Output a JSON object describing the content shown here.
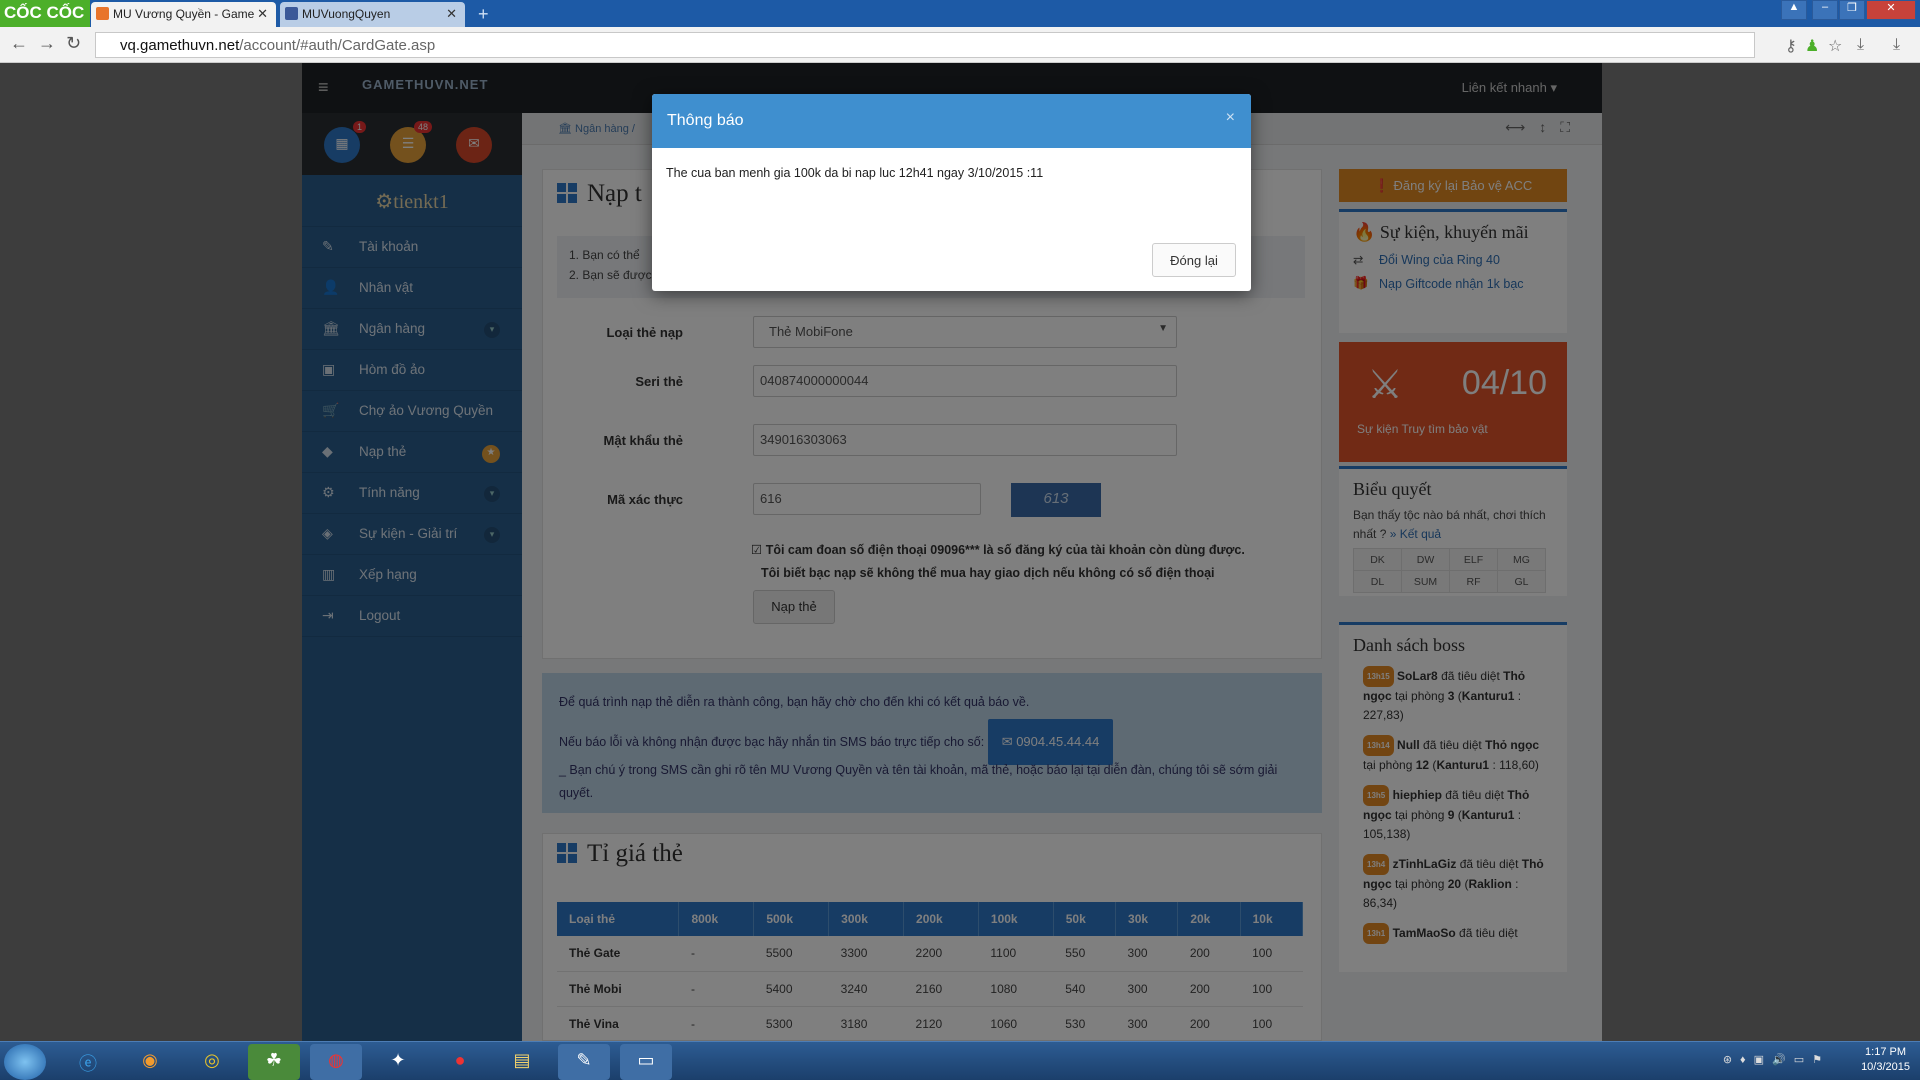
{
  "browser": {
    "brand": "CỐC CỐC",
    "tabs": [
      {
        "title": "MU Vương Quyền - Game"
      },
      {
        "title": "MUVuongQuyen"
      }
    ],
    "url_host": "vq.gamethuvn.net",
    "url_path": "/account/#auth/CardGate.asp"
  },
  "site": {
    "logo": "GAMETHUVN.NET",
    "quick_links": "Liên kết nhanh ▾",
    "badges": {
      "calendar": "1",
      "messages": "48"
    },
    "username": "tienkt1",
    "menu": [
      {
        "label": "Tài khoản",
        "icon": "✎"
      },
      {
        "label": "Nhân vật",
        "icon": "👤"
      },
      {
        "label": "Ngân hàng",
        "icon": "🏛"
      },
      {
        "label": "Hòm đồ ảo",
        "icon": "▣"
      },
      {
        "label": "Chợ ảo Vương Quyền",
        "icon": "🛒"
      },
      {
        "label": "Nạp thẻ",
        "icon": "◆"
      },
      {
        "label": "Tính năng",
        "icon": "⚙"
      },
      {
        "label": "Sự kiện - Giải trí",
        "icon": "◈"
      },
      {
        "label": "Xếp hạng",
        "icon": "▥"
      },
      {
        "label": "Logout",
        "icon": "⇥"
      }
    ],
    "breadcrumb": "Ngân hàng  /"
  },
  "form": {
    "title": "Nạp t",
    "notes": [
      "1. Bạn có thể",
      "2. Bạn sẽ được"
    ],
    "card_type_label": "Loại thẻ nạp",
    "card_type_value": "Thẻ MobiFone",
    "serial_label": "Seri thẻ",
    "serial_value": "040874000000044",
    "pin_label": "Mật khẩu thẻ",
    "pin_value": "349016303063",
    "captcha_label": "Mã xác thực",
    "captcha_value": "616",
    "captcha_image_text": "613",
    "agree_line1": "Tôi cam đoan số điện thoại 09096*** là số đăng ký của tài khoản còn dùng được.",
    "agree_line2": "Tôi biết bạc nạp sẽ không thể mua hay giao dịch nếu không có số điện thoại",
    "submit": "Nạp thẻ"
  },
  "info": {
    "line1": "Để quá trình nạp thẻ diễn ra thành công, bạn hãy chờ cho đến khi có kết quả báo về.",
    "line2": "Nếu báo lỗi và không nhận được bạc hãy nhắn tin SMS báo trực tiếp cho số:",
    "phone": "0904.45.44.44",
    "line3": "_ Bạn chú ý trong SMS cần ghi rõ tên MU Vương Quyền và tên tài khoản, mã thẻ, hoặc báo lại tại diễn đàn, chúng tôi sẽ sớm giải quyết."
  },
  "rates": {
    "title": "Tỉ giá thẻ",
    "headers": [
      "Loại thẻ",
      "800k",
      "500k",
      "300k",
      "200k",
      "100k",
      "50k",
      "30k",
      "20k",
      "10k"
    ],
    "rows": [
      [
        "Thẻ Gate",
        "-",
        "5500",
        "3300",
        "2200",
        "1100",
        "550",
        "300",
        "200",
        "100"
      ],
      [
        "Thẻ Mobi",
        "-",
        "5400",
        "3240",
        "2160",
        "1080",
        "540",
        "300",
        "200",
        "100"
      ],
      [
        "Thẻ Vina",
        "-",
        "5300",
        "3180",
        "2120",
        "1060",
        "530",
        "300",
        "200",
        "100"
      ]
    ]
  },
  "right": {
    "protect_button": "Đăng ký lại Bảo vệ ACC",
    "events_title": "Sự kiện, khuyến mãi",
    "events": [
      "Đổi Wing của Ring 40",
      "Nạp Giftcode nhận 1k bạc"
    ],
    "event_date": "04/10",
    "event_label": "Sự kiện Truy tìm bảo vật",
    "vote_title": "Biểu quyết",
    "vote_text": "Bạn thấy tộc nào bá nhất, chơi thích nhất ?",
    "vote_link": "» Kết quả",
    "classes": [
      "DK",
      "DW",
      "ELF",
      "MG",
      "DL",
      "SUM",
      "RF",
      "GL"
    ],
    "boss_title": "Danh sách boss",
    "boss": [
      {
        "time": "13h15",
        "player": "SoLar8",
        "text": "đã tiêu diệt",
        "boss": "Thỏ ngọc",
        "room_text": "tại phòng",
        "room": "3",
        "map": "Kanturu1",
        "coord": ": 227,83)"
      },
      {
        "time": "13h14",
        "player": "Null",
        "text": "đã tiêu diệt",
        "boss": "Thỏ ngọc",
        "room_text": "tại phòng",
        "room": "12",
        "map": "Kanturu1",
        "coord": ": 118,60)"
      },
      {
        "time": "13h5",
        "player": "hiephiep",
        "text": "đã tiêu diệt",
        "boss": "Thỏ ngọc",
        "room_text": "tại phòng",
        "room": "9",
        "map": "Kanturu1",
        "coord": ": 105,138)"
      },
      {
        "time": "13h4",
        "player": "zTinhLaGiz",
        "text": "đã tiêu diệt",
        "boss": "Thỏ ngọc",
        "room_text": "tại phòng",
        "room": "20",
        "map": "Raklion",
        "coord": ": 86,34)"
      },
      {
        "time": "13h1",
        "player": "TamMaoSo",
        "text": "đã tiêu diệt",
        "boss": "",
        "room_text": "",
        "room": "",
        "map": "",
        "coord": ""
      }
    ]
  },
  "modal": {
    "title": "Thông báo",
    "message": "The cua ban menh gia 100k da bi nap luc 12h41 ngay 3/10/2015 :11",
    "close_button": "Đóng lại",
    "close_x": "×"
  },
  "taskbar": {
    "time": "1:17 PM",
    "date": "10/3/2015"
  }
}
